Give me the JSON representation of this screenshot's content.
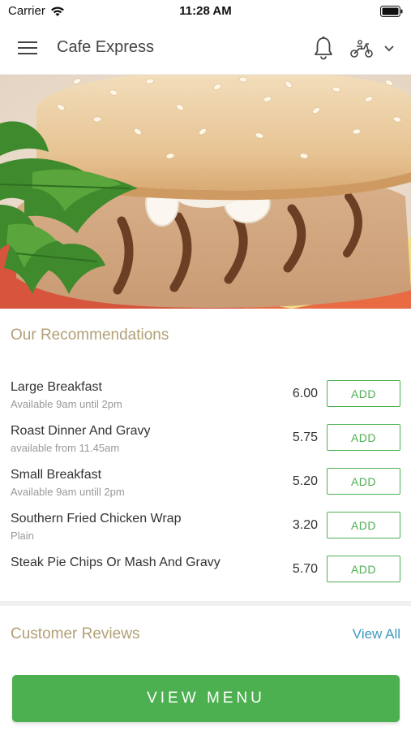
{
  "status_bar": {
    "carrier": "Carrier",
    "time": "11:28 AM",
    "wifi_icon": "wifi-icon",
    "battery_icon": "battery-icon"
  },
  "header": {
    "title": "Cafe Express",
    "menu_icon": "hamburger-menu-icon",
    "notification_icon": "bell-icon",
    "delivery_icon": "scooter-icon",
    "dropdown_icon": "chevron-down-icon"
  },
  "hero": {
    "image": "grilled-chicken-burger-photo"
  },
  "recommendations": {
    "title": "Our Recommendations",
    "items": [
      {
        "name": "Large Breakfast",
        "subtitle": "Available 9am until 2pm",
        "price": "6.00",
        "button": "ADD"
      },
      {
        "name": "Roast Dinner And Gravy",
        "subtitle": "available from 11.45am",
        "price": "5.75",
        "button": "ADD"
      },
      {
        "name": "Small Breakfast",
        "subtitle": "Available 9am untill 2pm",
        "price": "5.20",
        "button": "ADD"
      },
      {
        "name": "Southern Fried Chicken Wrap",
        "subtitle": "Plain",
        "price": "3.20",
        "button": "ADD"
      },
      {
        "name": "Steak Pie Chips Or Mash And Gravy",
        "subtitle": "",
        "price": "5.70",
        "button": "ADD"
      }
    ]
  },
  "reviews": {
    "title": "Customer Reviews",
    "view_all": "View All"
  },
  "footer": {
    "view_menu": "VIEW MENU"
  },
  "colors": {
    "accent_green": "#4caf50",
    "section_title": "#b29f76",
    "link_blue": "#3f9bbf"
  }
}
